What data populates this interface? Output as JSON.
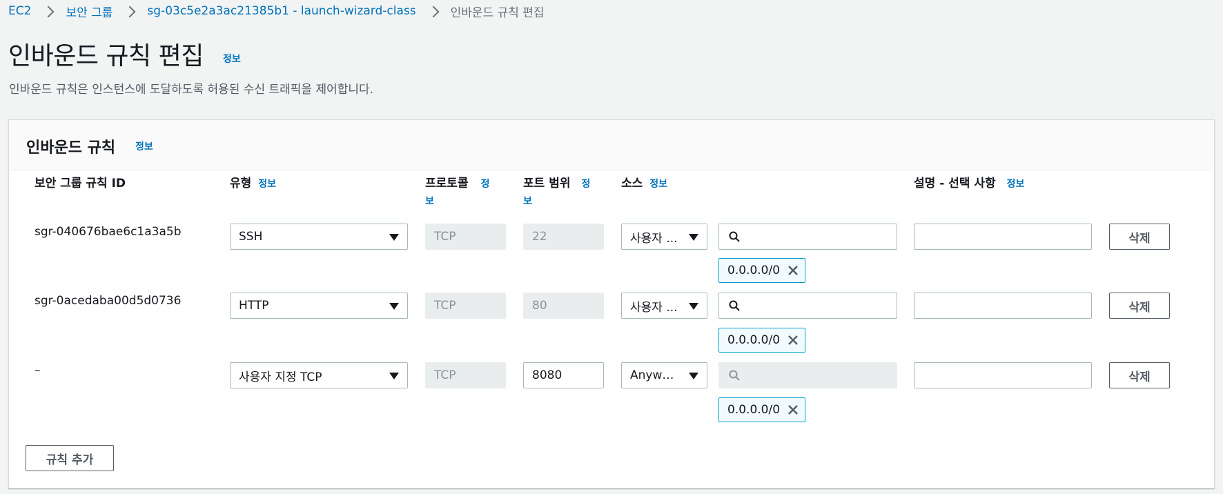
{
  "breadcrumb": {
    "items": [
      "EC2",
      "보안 그룹",
      "sg-03c5e2a3ac21385b1 - launch-wizard-class"
    ],
    "current": "인바운드 규칙 편집"
  },
  "header": {
    "title": "인바운드 규칙 편집",
    "info": "정보",
    "description": "인바운드 규칙은 인스턴스에 도달하도록 허용된 수신 트래픽을 제어합니다."
  },
  "panel": {
    "title": "인바운드 규칙",
    "info": "정보",
    "columns": {
      "rule_id": "보안 그룹 규칙 ID",
      "type": "유형",
      "protocol": "프로토콜",
      "port_range": "포트 범위",
      "source": "소스",
      "description": "설명 - 선택 사항",
      "info": "정보",
      "info_split_a": "정",
      "info_split_b": "보"
    },
    "rows": [
      {
        "rule_id": "sgr-040676bae6c1a3a5b",
        "type": "SSH",
        "protocol": "TCP",
        "port": "22",
        "source_type": "사용자 ...",
        "cidr": "0.0.0.0/0",
        "description": "",
        "delete_label": "삭제"
      },
      {
        "rule_id": "sgr-0acedaba00d5d0736",
        "type": "HTTP",
        "protocol": "TCP",
        "port": "80",
        "source_type": "사용자 ...",
        "cidr": "0.0.0.0/0",
        "description": "",
        "delete_label": "삭제"
      },
      {
        "rule_id": "–",
        "type": "사용자 지정 TCP",
        "protocol": "TCP",
        "port": "8080",
        "source_type": "Anywh...",
        "cidr": "0.0.0.0/0",
        "description": "",
        "delete_label": "삭제"
      }
    ],
    "add_rule_label": "규칙 추가"
  }
}
